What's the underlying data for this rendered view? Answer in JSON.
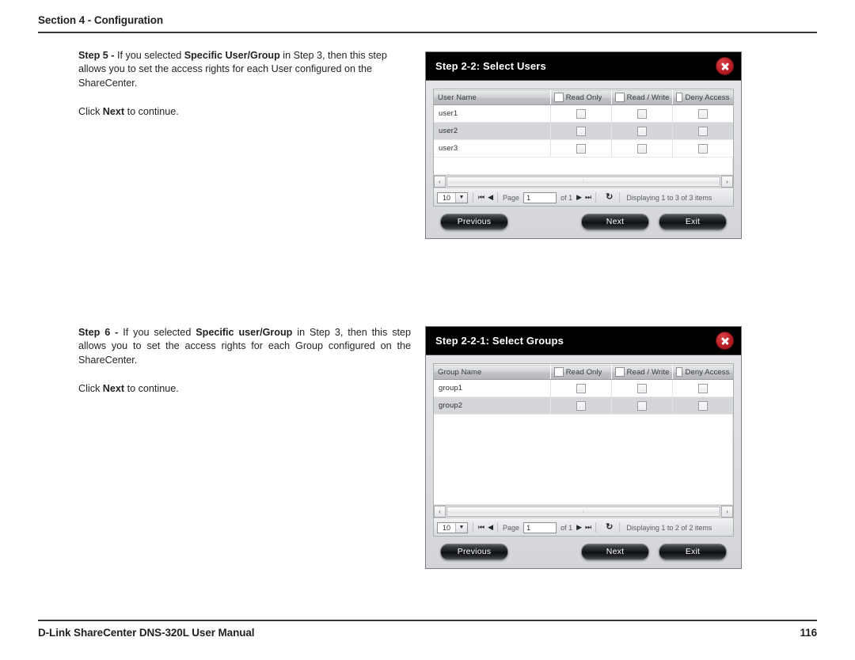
{
  "header": {
    "section_title": "Section 4 - Configuration"
  },
  "footer": {
    "manual_title": "D-Link ShareCenter DNS-320L User Manual",
    "page_number": "116"
  },
  "steps": [
    {
      "lead": "Step 5 - ",
      "text_1": "If you selected ",
      "emphasis": "Specific User/Group",
      "text_2": " in Step 3, then this step allows you to set the access rights for each User configured on the ShareCenter.",
      "click_pre": "Click ",
      "click_bold": "Next",
      "click_post": " to continue."
    },
    {
      "lead": "Step 6 - ",
      "text_1": "If you selected ",
      "emphasis": "Specific user/Group",
      "text_2": " in Step 3, then this step allows you to set the access rights for each Group configured on the ShareCenter.",
      "click_pre": "Click ",
      "click_bold": "Next",
      "click_post": " to continue."
    }
  ],
  "dialogs": [
    {
      "title": "Step 2-2: Select Users",
      "close_icon": "close-icon",
      "columns": [
        "User Name",
        "Read Only",
        "Read / Write",
        "Deny Access"
      ],
      "rows": [
        {
          "name": "user1",
          "read_only": false,
          "read_write": false,
          "deny": false
        },
        {
          "name": "user2",
          "read_only": false,
          "read_write": false,
          "deny": false
        },
        {
          "name": "user3",
          "read_only": false,
          "read_write": false,
          "deny": false
        }
      ],
      "scrollbar": {
        "left_arrow": "‹",
        "right_arrow": "›",
        "grip": "∶"
      },
      "pager": {
        "page_size": "10",
        "dropdown_arrow": "▼",
        "first_icon": "⏮",
        "prev_icon": "◀",
        "page_label": "Page",
        "page_value": "1",
        "of_label": "of 1",
        "next_icon": "▶",
        "last_icon": "⏭",
        "refresh_icon": "↻",
        "display_text": "Displaying 1 to 3 of 3 items"
      },
      "buttons": {
        "previous": "Previous",
        "next": "Next",
        "exit": "Exit"
      }
    },
    {
      "title": "Step 2-2-1: Select Groups",
      "close_icon": "close-icon",
      "columns": [
        "Group Name",
        "Read Only",
        "Read / Write",
        "Deny Access"
      ],
      "rows": [
        {
          "name": "group1",
          "read_only": false,
          "read_write": false,
          "deny": false
        },
        {
          "name": "group2",
          "read_only": false,
          "read_write": false,
          "deny": false
        }
      ],
      "scrollbar": {
        "left_arrow": "‹",
        "right_arrow": "›",
        "grip": "∶"
      },
      "pager": {
        "page_size": "10",
        "dropdown_arrow": "▼",
        "first_icon": "⏮",
        "prev_icon": "◀",
        "page_label": "Page",
        "page_value": "1",
        "of_label": "of 1",
        "next_icon": "▶",
        "last_icon": "⏭",
        "refresh_icon": "↻",
        "display_text": "Displaying 1 to 2 of 2 items"
      },
      "buttons": {
        "previous": "Previous",
        "next": "Next",
        "exit": "Exit"
      }
    }
  ]
}
